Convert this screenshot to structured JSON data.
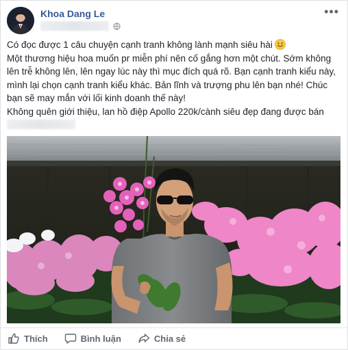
{
  "post": {
    "author": "Khoa Dang Le",
    "paragraphs": [
      "Có đọc được 1 câu chuyện cạnh tranh không lành mạnh siêu hài",
      "Một thương hiệu hoa muốn pr miễn phí nên cố gắng hơn một chút. Sớm không lên trễ không lên, lên ngay lúc này thì mục đích quá rõ. Bạn cạnh tranh kiểu này, mình lại chọn cạnh tranh kiểu khác. Bản lĩnh và trượng phu lên bạn nhé! Chúc bạn sẽ may mắn với lối kinh doanh thế này!",
      "Không quên giới thiệu, lan hồ điệp Apollo 220k/cành siêu đẹp đang được bán"
    ]
  },
  "actions": {
    "like": "Thích",
    "comment": "Bình luận",
    "share": "Chia sẻ"
  },
  "colors": {
    "author": "#365899",
    "action_text": "#606770",
    "orchid": "#e86fc0"
  },
  "icons": [
    "more-options-icon",
    "globe-icon",
    "smiley-icon",
    "like-icon",
    "comment-icon",
    "share-icon"
  ]
}
